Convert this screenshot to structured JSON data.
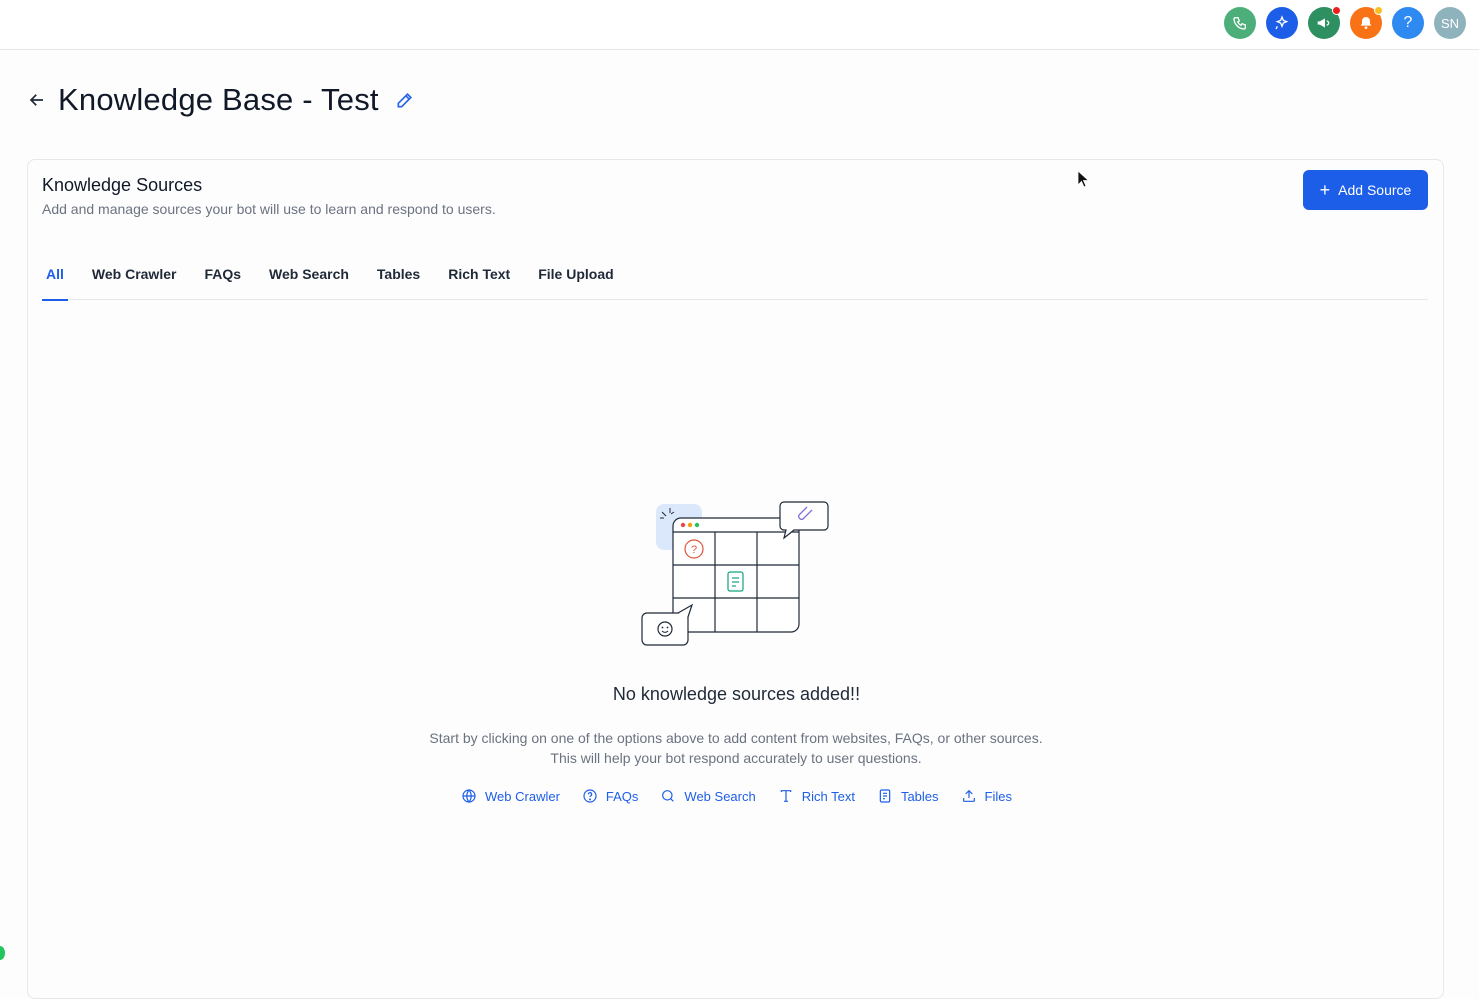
{
  "header": {
    "avatar_initials": "SN",
    "icons": [
      {
        "name": "phone-icon",
        "color": "#4caf7a"
      },
      {
        "name": "sparkle-icon",
        "color": "#1d5ee8"
      },
      {
        "name": "megaphone-icon",
        "color": "#2e9060",
        "badge_color": "#ef1e1e"
      },
      {
        "name": "bell-icon",
        "color": "#f97316",
        "badge_color": "#fbbf24"
      },
      {
        "name": "help-icon",
        "color": "#2e8af0"
      }
    ]
  },
  "page": {
    "title": "Knowledge Base - Test"
  },
  "card": {
    "title": "Knowledge Sources",
    "subtitle": "Add and manage sources your bot will use to learn and respond to users.",
    "add_button_label": "Add Source"
  },
  "tabs": [
    {
      "label": "All",
      "active": true
    },
    {
      "label": "Web Crawler"
    },
    {
      "label": "FAQs"
    },
    {
      "label": "Web Search"
    },
    {
      "label": "Tables"
    },
    {
      "label": "Rich Text"
    },
    {
      "label": "File Upload"
    }
  ],
  "empty_state": {
    "title": "No knowledge sources added!!",
    "description": "Start by clicking on one of the options above to add content from websites, FAQs, or other sources. This will help your bot respond accurately to user questions.",
    "links": [
      {
        "label": "Web Crawler",
        "icon": "globe-icon"
      },
      {
        "label": "FAQs",
        "icon": "question-circle-icon"
      },
      {
        "label": "Web Search",
        "icon": "search-icon"
      },
      {
        "label": "Rich Text",
        "icon": "text-icon"
      },
      {
        "label": "Tables",
        "icon": "table-doc-icon"
      },
      {
        "label": "Files",
        "icon": "upload-icon"
      }
    ]
  },
  "colors": {
    "accent": "#1d5ee8"
  }
}
